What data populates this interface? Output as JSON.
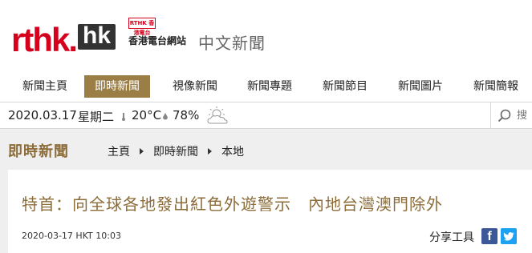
{
  "header": {
    "logo_main": "rthk.",
    "logo_hk": "hk",
    "logo_stamp": "RTHK 香港電台",
    "logo_site": "香港電台網站",
    "section": "中文新聞"
  },
  "nav": {
    "items": [
      {
        "label": "新聞主頁"
      },
      {
        "label": "即時新聞",
        "active": true
      },
      {
        "label": "視像新聞"
      },
      {
        "label": "新聞專題"
      },
      {
        "label": "新聞節目"
      },
      {
        "label": "新聞圖片"
      },
      {
        "label": "新聞簡報"
      }
    ]
  },
  "infobar": {
    "date": "2020.03.17",
    "weekday": "星期二",
    "temperature": "20°C",
    "humidity": "78%",
    "weather_icon": "partly-cloudy-sun-icon",
    "search_placeholder": "搜"
  },
  "section": {
    "title": "即時新聞",
    "breadcrumb": [
      "主頁",
      "即時新聞",
      "本地"
    ]
  },
  "article": {
    "headline": "特首：向全球各地發出紅色外遊警示　內地台灣澳門除外",
    "timestamp": "2020-03-17 HKT 10:03",
    "share_label": "分享工具",
    "facebook_glyph": "f"
  },
  "colors": {
    "brand_red": "#d6001c",
    "accent_gold": "#9b7e45",
    "headline_gold": "#8c6d3a",
    "facebook": "#3b5998",
    "twitter": "#1da1f2"
  }
}
